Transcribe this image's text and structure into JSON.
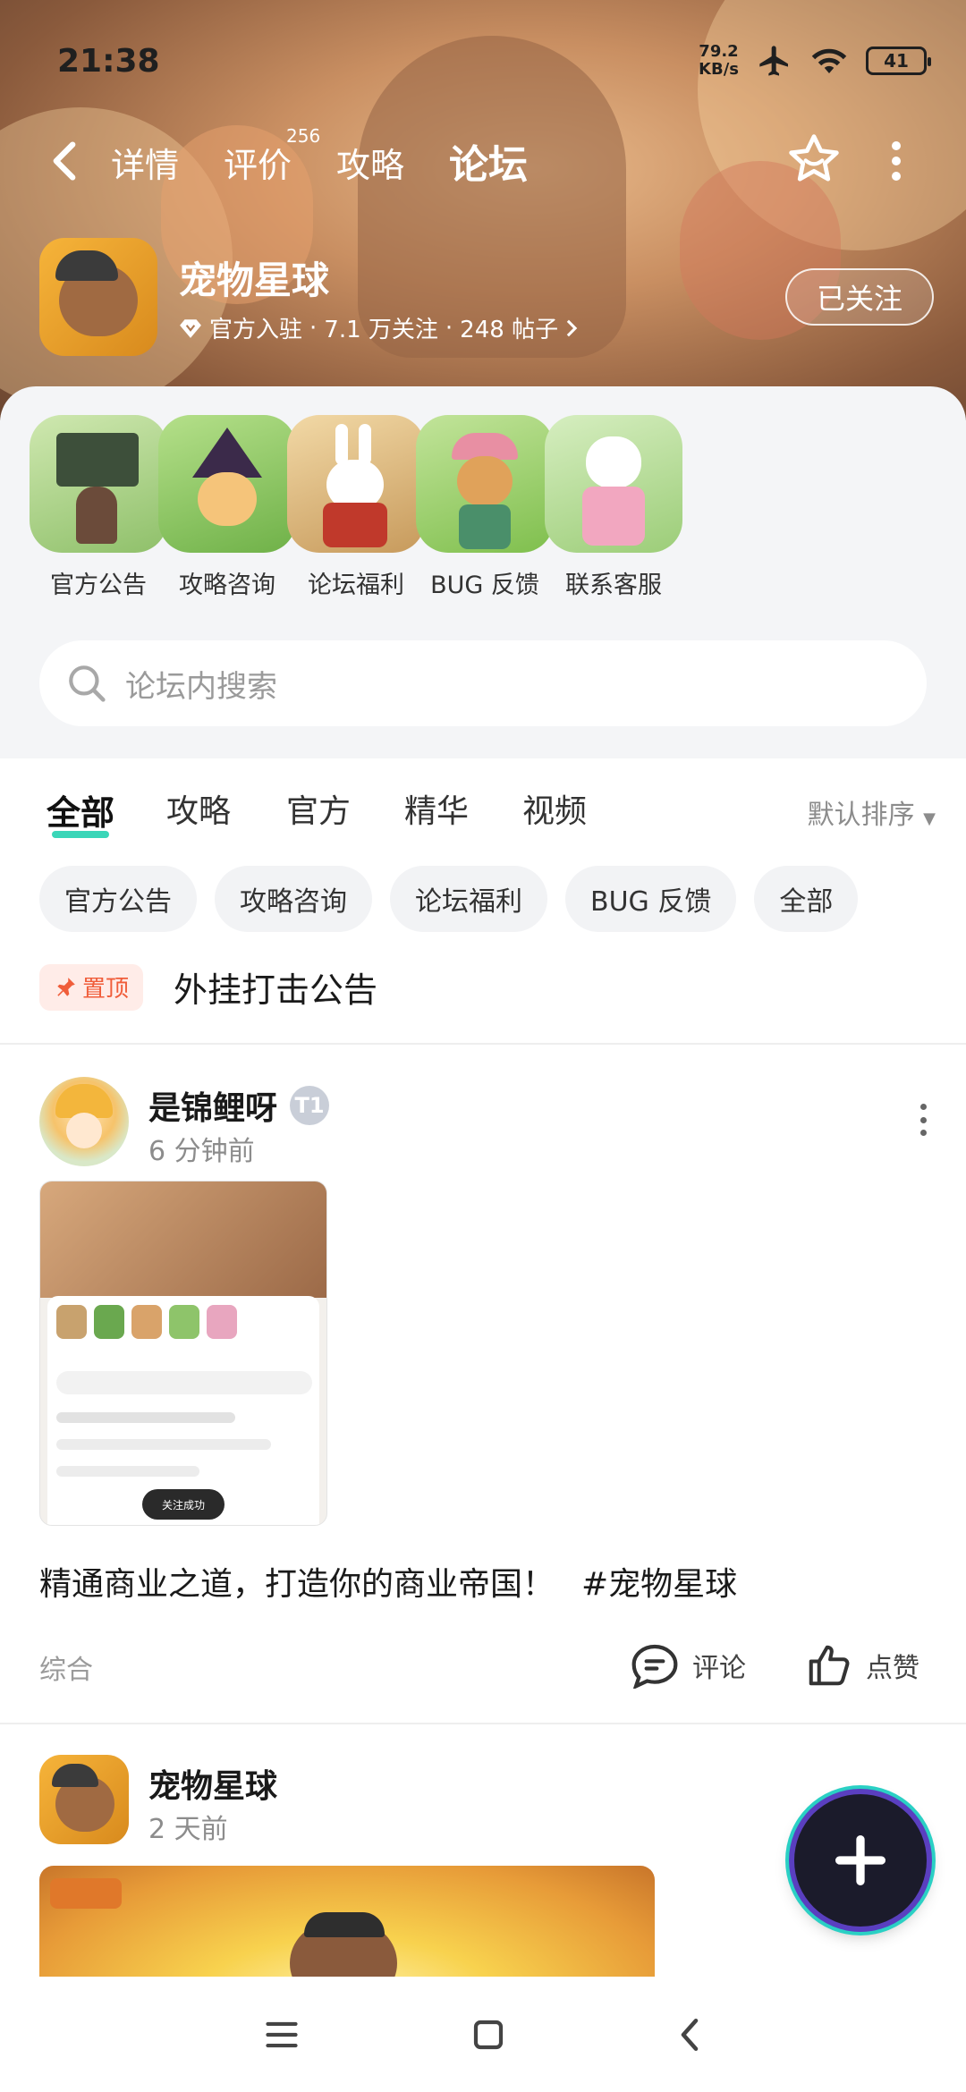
{
  "status_bar": {
    "time": "21:38",
    "net_speed_value": "79.2",
    "net_speed_unit": "KB/s",
    "battery": "41"
  },
  "nav": {
    "tabs": [
      {
        "label": "详情"
      },
      {
        "label": "评价"
      },
      {
        "label": "攻略"
      },
      {
        "label": "论坛"
      }
    ],
    "review_count": "256",
    "active_tab": "论坛"
  },
  "game": {
    "name": "宠物星球",
    "official": "官方入驻",
    "followers": "7.1 万关注",
    "posts": "248 帖子",
    "follow_label": "已关注"
  },
  "categories": [
    {
      "label": "官方公告"
    },
    {
      "label": "攻略咨询"
    },
    {
      "label": "论坛福利"
    },
    {
      "label": "BUG 反馈"
    },
    {
      "label": "联系客服"
    }
  ],
  "search": {
    "placeholder": "论坛内搜索"
  },
  "feed_tabs": {
    "tabs": [
      {
        "label": "全部"
      },
      {
        "label": "攻略"
      },
      {
        "label": "官方"
      },
      {
        "label": "精华"
      },
      {
        "label": "视频"
      }
    ],
    "sort": "默认排序"
  },
  "chips": [
    {
      "label": "官方公告"
    },
    {
      "label": "攻略咨询"
    },
    {
      "label": "论坛福利"
    },
    {
      "label": "BUG 反馈"
    },
    {
      "label": "全部"
    }
  ],
  "pinned": {
    "badge": "置顶",
    "title": "外挂打击公告"
  },
  "posts": [
    {
      "author": "是锦鲤呀",
      "level": "T1",
      "time": "6 分钟前",
      "text": "精通商业之道，打造你的商业帝国！",
      "tag": "#宠物星球",
      "category": "综合",
      "comment_label": "评论",
      "like_label": "点赞",
      "thumb": {
        "toast": "关注成功"
      }
    },
    {
      "author": "宠物星球",
      "time": "2 天前"
    }
  ],
  "colors": {
    "accent": "#3ad6b8",
    "pin": "#f05d3a"
  }
}
